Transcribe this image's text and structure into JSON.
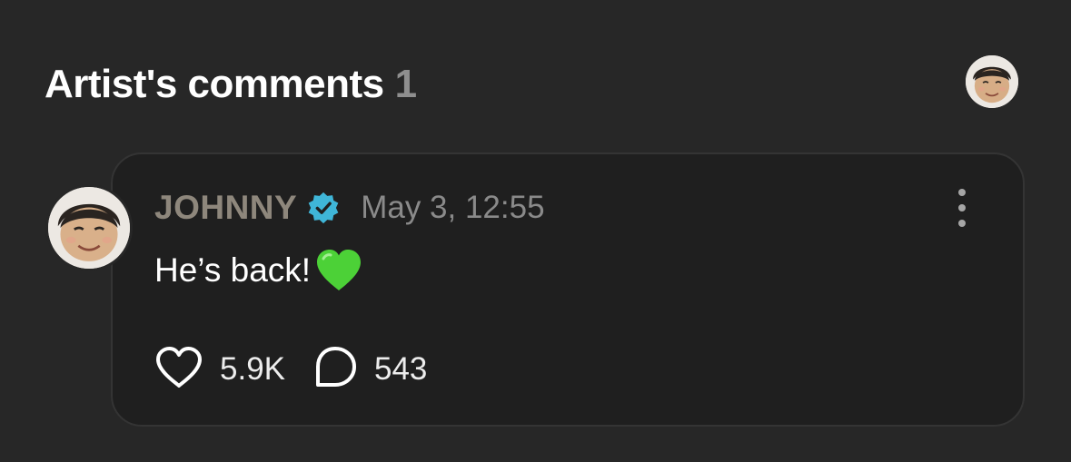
{
  "section": {
    "title": "Artist's comments",
    "count": "1"
  },
  "comment": {
    "author": "JOHNNY",
    "timestamp": "May 3, 12:55",
    "text": "He’s back!",
    "likes": "5.9K",
    "replies": "543"
  },
  "icons": {
    "verified": "verified-check-icon",
    "more": "more-vertical-icon",
    "like": "heart-outline-icon",
    "reply": "speech-bubble-icon",
    "emoji": "green-heart-emoji"
  },
  "colors": {
    "background": "#272727",
    "card": "#1f1f1f",
    "author": "#8e877c",
    "verified": "#3fb6d8",
    "emoji": "#4cd137"
  }
}
